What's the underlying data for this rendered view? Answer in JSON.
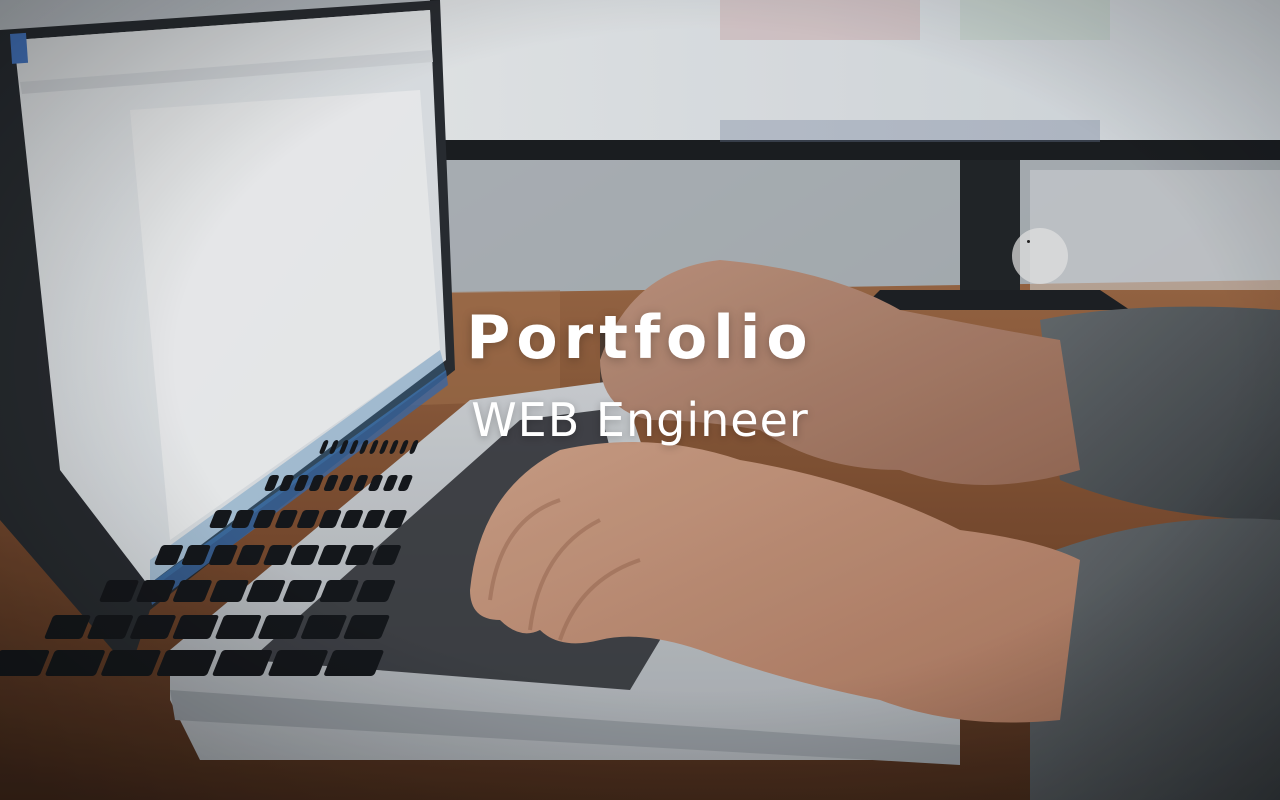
{
  "hero": {
    "title": "Portfolio",
    "subtitle": "WEB Engineer"
  },
  "colors": {
    "text": "#ffffff",
    "desk": "#7a4a2c",
    "sweater": "#4f5457",
    "screen": "#eef1f3",
    "laptop_body": "#cfd2d6",
    "keys": "#1a1c1f"
  },
  "icons": {
    "cursor": "circle-cursor-icon"
  }
}
